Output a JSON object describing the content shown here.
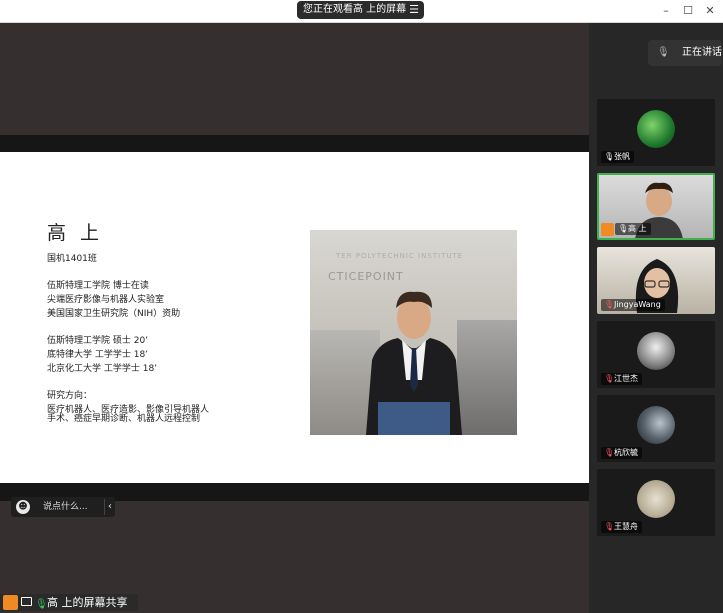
{
  "titlebar": {
    "viewing_text": "您正在观看高 上的屏幕",
    "menu_icon": "menu-icon",
    "minimize": "–",
    "maximize": "☐",
    "close": "✕"
  },
  "slide": {
    "name": "高 上",
    "class": "国机1401班",
    "lines_a": [
      "伍斯特理工学院 博士在读",
      "尖端医疗影像与机器人实验室",
      "美国国家卫生研究院（NIH）资助"
    ],
    "lines_b": [
      "伍斯特理工学院 硕士 20’",
      "底特律大学 工学学士 18’",
      "北京化工大学 工学学士 18’"
    ],
    "research_label": "研究方向：",
    "research_lines": [
      "医疗机器人、医疗造影、影像引导机器人",
      "手术、癌症早期诊断、机器人远程控制"
    ],
    "photo_sign": "CTICEPOINT",
    "photo_sign_top": "TER POLYTECHNIC INSTITUTE"
  },
  "chat": {
    "placeholder": "说点什么...",
    "collapse": "‹"
  },
  "share_label": "高 上的屏幕共享",
  "right_panel": {
    "speaking": "正在讲话:",
    "participants": [
      {
        "name": "张帆",
        "mic": "on",
        "active": false,
        "host": false
      },
      {
        "name": "高 上",
        "mic": "on",
        "active": true,
        "host": true
      },
      {
        "name": "JingyaWang",
        "mic": "muted",
        "active": false,
        "host": false
      },
      {
        "name": "江世杰",
        "mic": "muted",
        "active": false,
        "host": false
      },
      {
        "name": "杭欣毓",
        "mic": "muted",
        "active": false,
        "host": false
      },
      {
        "name": "王慧舟",
        "mic": "muted",
        "active": false,
        "host": false
      }
    ]
  },
  "colors": {
    "accent_green": "#3fb04c",
    "host_orange": "#f08a24",
    "muted_red": "#ff5a5a"
  }
}
